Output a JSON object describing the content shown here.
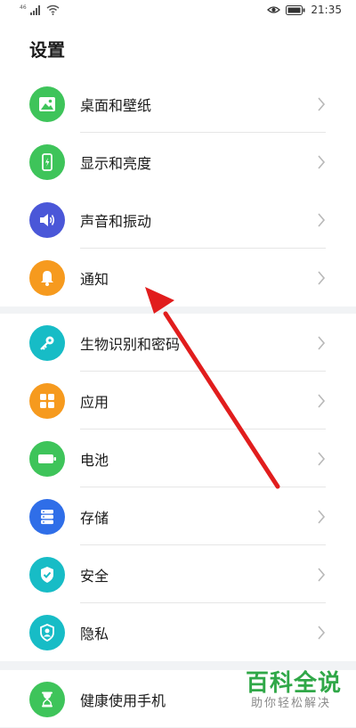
{
  "status_bar": {
    "network": "46",
    "time": "21:35"
  },
  "page_title": "设置",
  "groups": [
    [
      {
        "label": "桌面和壁纸",
        "icon": "image-icon",
        "color": "#3ec45a"
      },
      {
        "label": "显示和亮度",
        "icon": "phone-brightness-icon",
        "color": "#3ec45a"
      }
    ],
    [
      {
        "label": "声音和振动",
        "icon": "speaker-icon",
        "color": "#4a57d8"
      },
      {
        "label": "通知",
        "icon": "bell-icon",
        "color": "#f69a1e"
      }
    ],
    [
      {
        "label": "生物识别和密码",
        "icon": "key-icon",
        "color": "#17bcc6"
      },
      {
        "label": "应用",
        "icon": "apps-grid-icon",
        "color": "#f69a1e"
      },
      {
        "label": "电池",
        "icon": "battery-icon",
        "color": "#3ec45a"
      },
      {
        "label": "存储",
        "icon": "storage-icon",
        "color": "#2f6ee8"
      },
      {
        "label": "安全",
        "icon": "shield-check-icon",
        "color": "#17bcc6"
      },
      {
        "label": "隐私",
        "icon": "privacy-shield-icon",
        "color": "#17bcc6"
      }
    ],
    [
      {
        "label": "健康使用手机",
        "icon": "hourglass-icon",
        "color": "#3ec45a"
      }
    ]
  ],
  "watermark": {
    "title": "百科全说",
    "subtitle": "助你轻松解决"
  },
  "annotation": {
    "type": "arrow",
    "color": "#e11d1d",
    "points_to": "通知"
  }
}
